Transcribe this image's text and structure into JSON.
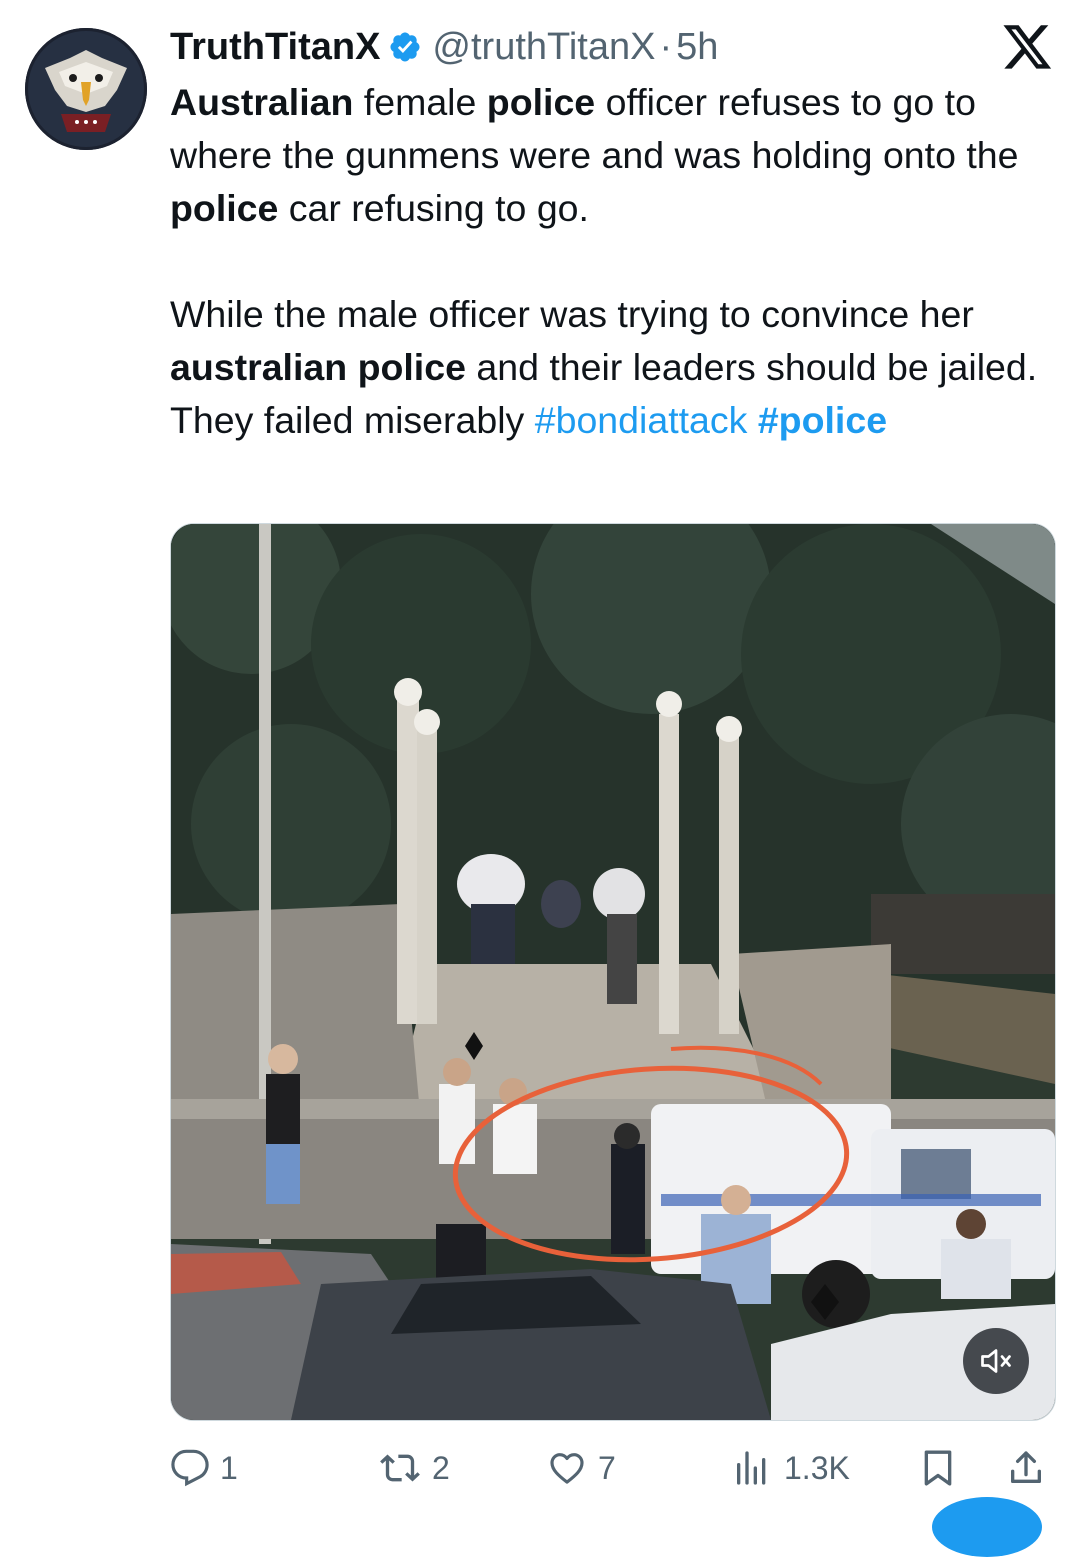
{
  "author": {
    "display_name": "TruthTitanX",
    "handle": "@truthTitanX",
    "separator": "·",
    "time_ago": "5h",
    "avatar_icon": "eagle-avatar-icon",
    "verified_icon": "verified-badge-icon"
  },
  "platform": {
    "logo_icon": "x-logo-icon"
  },
  "tweet": {
    "p1": {
      "s1": "Australian",
      "s2": " female ",
      "s3": "police",
      "s4": " officer refuses to go to where the gunmens were and was holding onto the ",
      "s5": "police",
      "s6": " car refusing to go."
    },
    "p2": {
      "s1": "While the male officer was trying to convince her ",
      "s2": "australian police",
      "s3": " and their leaders should be jailed. They failed miserably ",
      "hashtag1": "#bondiattack",
      "s4": " ",
      "hashtag2": "#police"
    }
  },
  "media": {
    "type": "video",
    "description_icon": "video-thumbnail",
    "mute_icon": "speaker-muted-icon"
  },
  "actions": {
    "reply": {
      "icon": "reply-icon",
      "count": "1"
    },
    "repost": {
      "icon": "repost-icon",
      "count": "2"
    },
    "like": {
      "icon": "heart-icon",
      "count": "7"
    },
    "views": {
      "icon": "views-icon",
      "count": "1.3K"
    },
    "bookmark": {
      "icon": "bookmark-icon"
    },
    "share": {
      "icon": "share-icon"
    }
  },
  "colors": {
    "text": "#0f1419",
    "secondary": "#536471",
    "accent": "#1d9bf0",
    "circle_annotation": "#e8613a"
  }
}
